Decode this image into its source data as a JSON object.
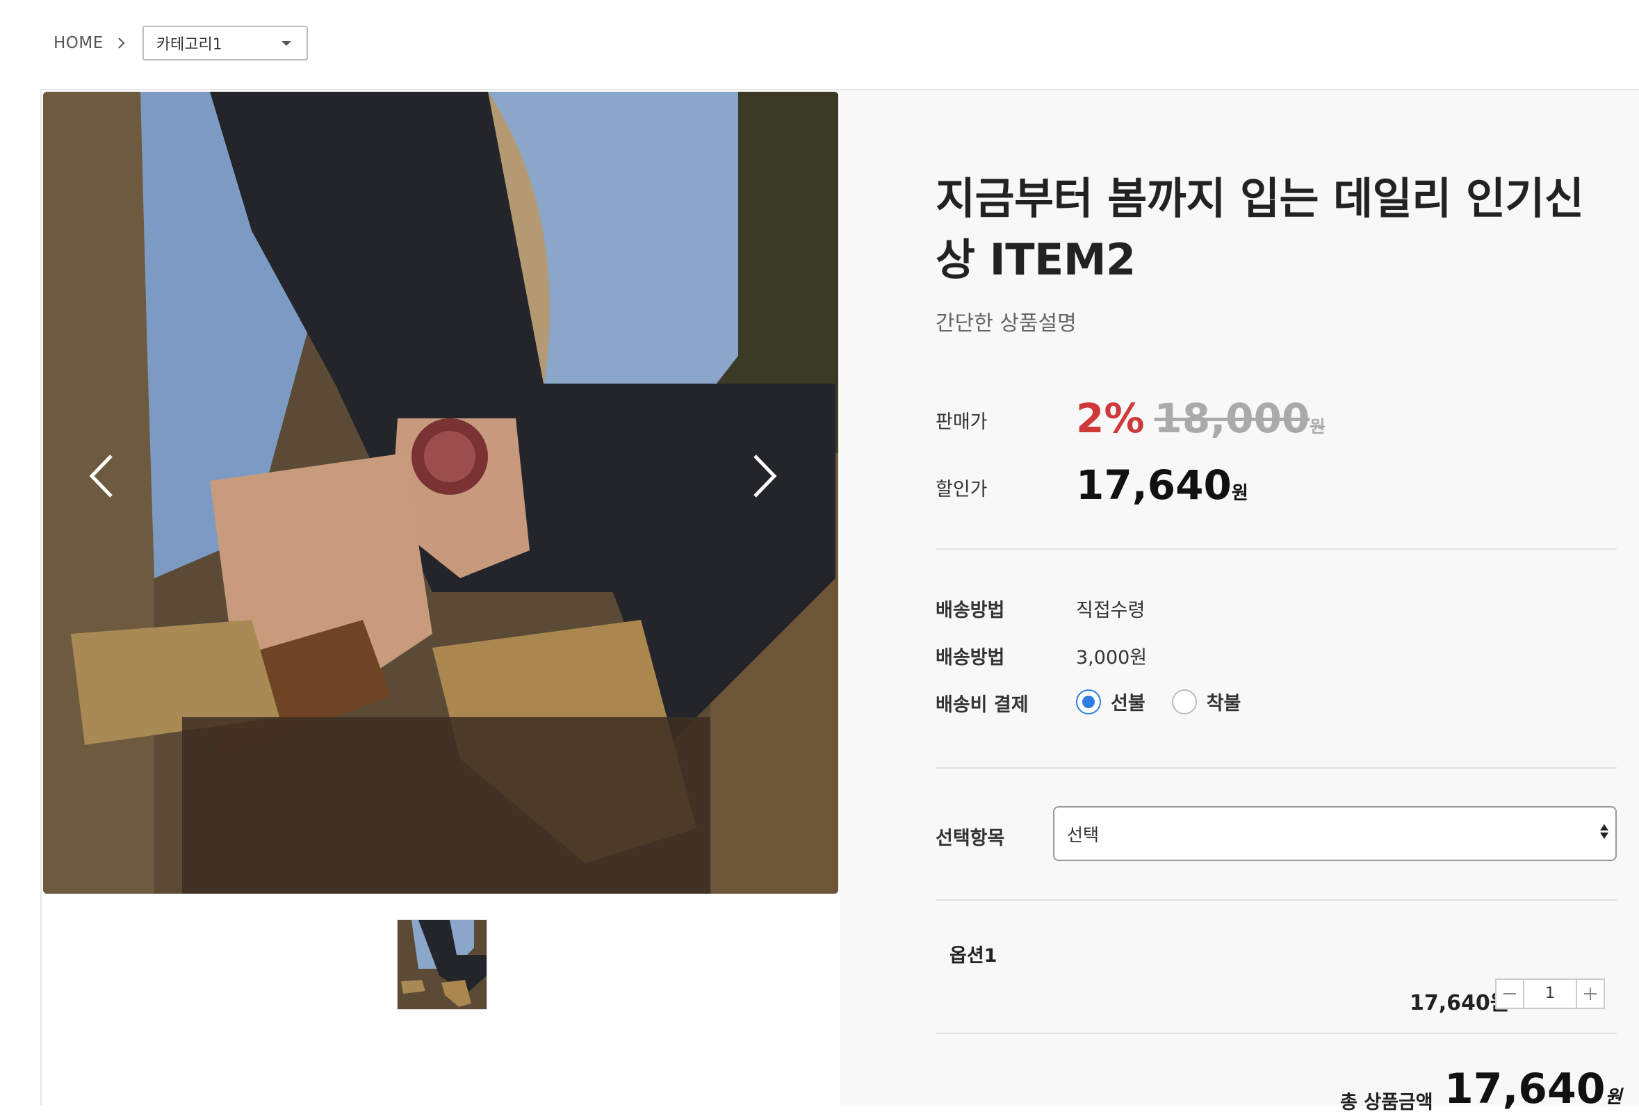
{
  "breadcrumb": {
    "home": "HOME",
    "category": "카테고리1"
  },
  "product": {
    "title": "지금부터 봄까지 입는 데일리 인기신상 ITEM2",
    "subtitle": "간단한 상품설명",
    "price_label": "판매가",
    "discount_rate": "2%",
    "original_price": "18,000",
    "original_unit": "원",
    "sale_label": "할인가",
    "sale_price": "17,640",
    "sale_unit": "원"
  },
  "shipping": {
    "method_label": "배송방법",
    "method_value": "직접수령",
    "fee_label": "배송방법",
    "fee_value": "3,000원",
    "payment_label": "배송비 결제",
    "options": [
      {
        "label": "선불",
        "checked": true
      },
      {
        "label": "착불",
        "checked": false
      }
    ]
  },
  "option_select": {
    "label": "선택항목",
    "value": "선택"
  },
  "selected_option": {
    "name": "옵션1",
    "price": "17,640원",
    "quantity": "1"
  },
  "total": {
    "label": "총 상품금액",
    "value": "17,640",
    "unit": "원"
  },
  "colors": {
    "discount": "#d0393a",
    "radio_active": "#2f7de1",
    "panel_bg": "#f8f8f8"
  }
}
